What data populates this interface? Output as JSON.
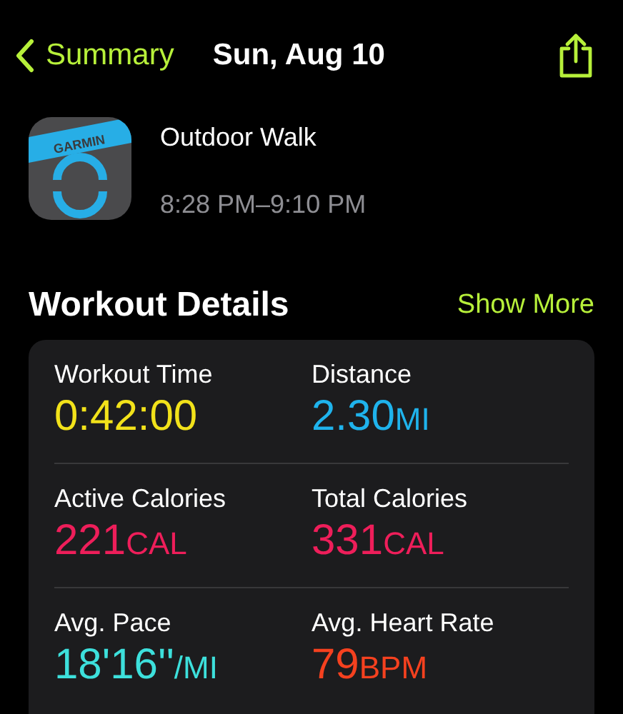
{
  "nav": {
    "back_label": "Summary",
    "title": "Sun, Aug 10"
  },
  "workout": {
    "app_icon_label": "GARMIN",
    "name": "Outdoor Walk",
    "time_range": "8:28 PM–9:10 PM"
  },
  "section": {
    "title": "Workout Details",
    "action": "Show More"
  },
  "metrics": [
    {
      "label": "Workout Time",
      "value": "0:42:00",
      "color": "#f2e21a"
    },
    {
      "label": "Distance",
      "value": "2.30",
      "unit": "MI",
      "color": "#1fb3ec"
    },
    {
      "label": "Active Calories",
      "value": "221",
      "unit": "CAL",
      "color": "#ee1e5a"
    },
    {
      "label": "Total Calories",
      "value": "331",
      "unit": "CAL",
      "color": "#ee1e5a"
    },
    {
      "label": "Avg. Pace",
      "value": "18'16''",
      "unit": "/MI",
      "color": "#3de0dc"
    },
    {
      "label": "Avg. Heart Rate",
      "value": "79",
      "unit": "BPM",
      "color": "#f5411f"
    }
  ]
}
